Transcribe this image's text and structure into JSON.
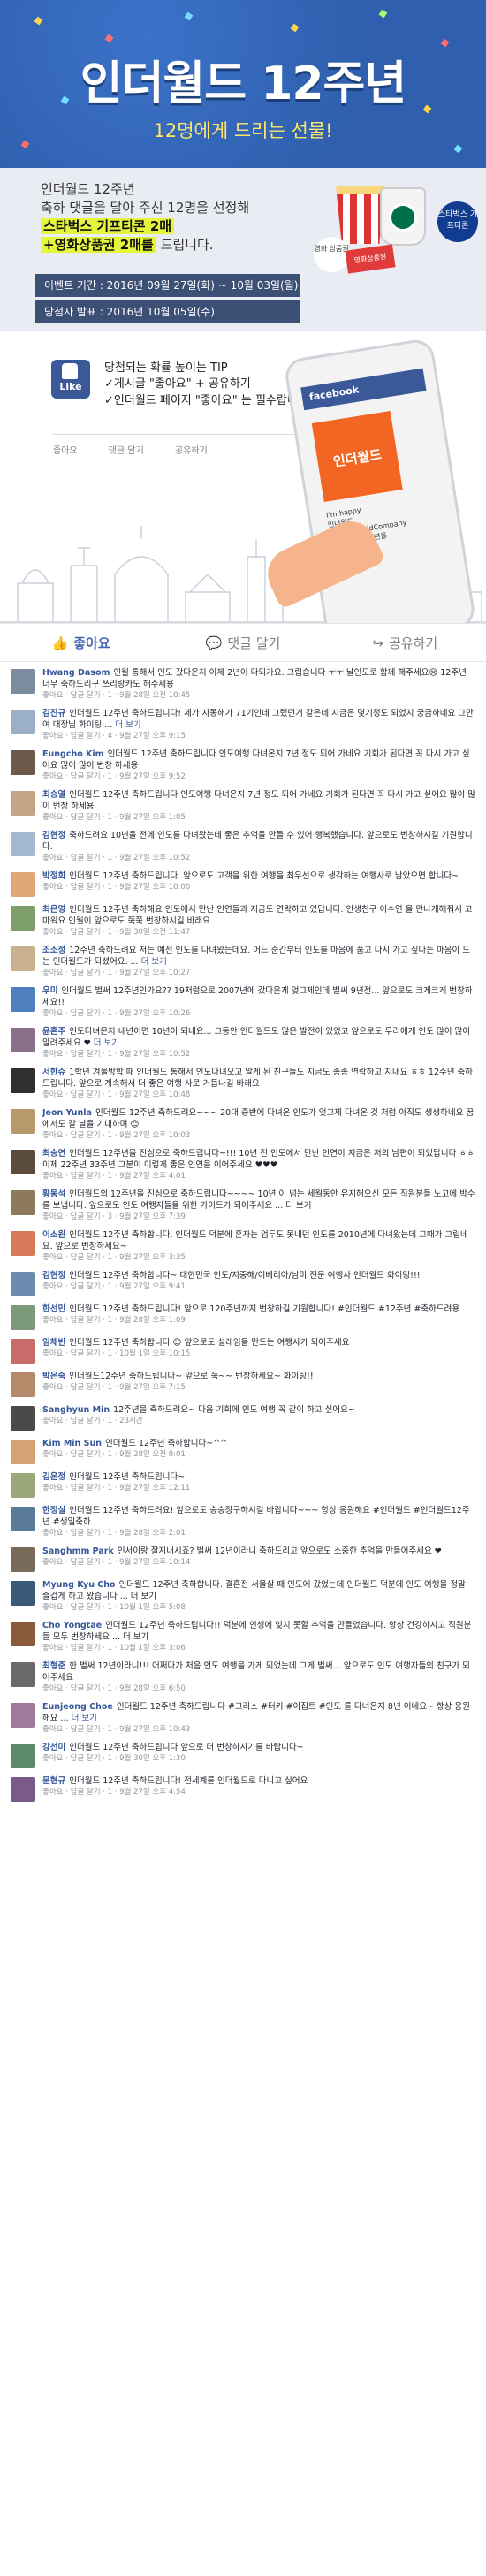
{
  "hero": {
    "title": "인더월드 12주년",
    "subtitle": "12명에게 드리는 선물!"
  },
  "event": {
    "line1": "인더월드 12주년",
    "line2": "축하 댓글을 달아 주신 12명을 선정해",
    "prize1": "스타벅스 기프티콘 2매",
    "prize2": "+영화상품권 2매를",
    "prize_suffix": " 드립니다.",
    "period": "이벤트 기간 : 2016년 09월 27일(화) ~ 10월 03일(월)",
    "announce": "당첨자 발표 : 2016년 10월 05일(수)",
    "starbucks_tag": "스타벅스 기프티콘",
    "movie_tag": "영화 상품권",
    "ticket": "영화상품권",
    "popcorn": "POPCORN"
  },
  "tip": {
    "title": "당첨되는 확률 높이는 TIP",
    "line1": "✓게시글 \"좋아요\" + 공유하기",
    "line2": "✓인더월드 페이지 \"좋아요\" 는 필수랍니다.",
    "like_badge": "Like",
    "actions": [
      "좋아요",
      "댓글 달기",
      "공유하기"
    ],
    "phone_header": "facebook",
    "phone_card": "인더월드",
    "phone_caption1": "I'm happy",
    "phone_caption2": "인더월드\n@IntheworldCompany\n인더월드 12주년을\n축하드립니다"
  },
  "actions": {
    "like": "좋아요",
    "comment": "댓글 달기",
    "share": "공유하기"
  },
  "comments": [
    {
      "name": "Hwang Dasom",
      "text": "인월 통해서 인도 갔다온지 이제 2년이 다되가요. 그립습니다 ㅜㅜ 날인도로 함께 해주세요😢 12주년 너무 축하드리구 쓰리랑카도 해주세용",
      "more": "",
      "meta": "좋아요 · 답글 달기 · 1 · 9월 28일 오전 10:45",
      "color": "#7a8c9e"
    },
    {
      "name": "김진규",
      "text": "인더월드 12주년 축하드립니다! 제가 자몽해가 71기인데 그랬던거 같은데 지금은 몇기정도 되었지 궁금하네요 그만 여 대장님 화이팅 ...",
      "more": "더 보기",
      "meta": "좋아요 · 답글 달기 · 4 · 9월 27일 오후 9:15",
      "color": "#9bb0c6"
    },
    {
      "name": "Eungcho Kim",
      "text": "인더월드 12주년 축하드립니다 인도여행 다녀온지 7년 정도 되어 가네요 기회가 된다면 꼭 다시 가고 싶어요 많이 많이 번창 하세용",
      "more": "",
      "meta": "좋아요 · 답글 달기 · 1 · 9월 27일 오후 9:52",
      "color": "#6d5a4a"
    },
    {
      "name": "최승열",
      "text": "인더월드 12주년 축하드립니다 인도여행 다녀온지 7년 정도 되어 가네요 기회가 된다면 꼭 다시 가고 싶어요 많이 많이 번창 하세용",
      "more": "",
      "meta": "좋아요 · 답글 달기 · 1 · 9월 27일 오후 1:05",
      "color": "#c4a484"
    },
    {
      "name": "김현정",
      "text": "축하드려요 10년을 전에 인도를 다녀왔는데 좋은 추억을 만들 수 있어 행복했습니다. 앞으로도 번창하시길 기원합니다.",
      "more": "",
      "meta": "좋아요 · 답글 달기 · 1 · 9월 27일 오후 10:52",
      "color": "#a3b9cf"
    },
    {
      "name": "박정희",
      "text": "인더월드 12주년 축하드립니다. 앞으로도 고객을 위한 여행을 최우선으로 생각하는 여행사로 남았으면 합니다~",
      "more": "",
      "meta": "좋아요 · 답글 달기 · 1 · 9월 27일 오후 10:00",
      "color": "#e0a878"
    },
    {
      "name": "최은영",
      "text": "인더월드 12주년 축하해요 인도에서 만난 인연들과 지금도 연락하고 있답니다. 인생친구 이수연 을 만나게해줘서 고마워요 인월이 앞으로도 쭉쭉 번창하시길 바래요",
      "more": "",
      "meta": "좋아요 · 답글 달기 · 1 · 9월 30일 오전 11:47",
      "color": "#7f9f6a"
    },
    {
      "name": "조소정",
      "text": "12주년 축하드려요 저는 예전 인도를 다녀왔는데요. 어느 순간부터 인도를 마음에 품고 다시 가고 싶다는 마음이 드는 인더월드가 되셨어요. ...",
      "more": "더 보기",
      "meta": "좋아요 · 답글 달기 · 1 · 9월 27일 오후 10:27",
      "color": "#c9b18e"
    },
    {
      "name": "우미",
      "text": "인더월드 벌써 12주년인가요?? 19처럼으로 2007년에 갔다온게 엊그제인데 벌써 9년전... 앞으로도 크게크게 번창하세요!!",
      "more": "",
      "meta": "좋아요 · 답글 달기 · 1 · 9월 27일 오후 10:26",
      "color": "#4e7fbf"
    },
    {
      "name": "윤혼주",
      "text": "인도다녀온지 내년이면 10년이 되네요... 그동안 인더월드도 많은 발전이 있었고 앞으로도 우리에게 인도 많이 많이 알려주세요 ❤",
      "more": "더 보기",
      "meta": "좋아요 · 답글 달기 · 1 · 9월 27일 오후 10:52",
      "color": "#8a6f8a"
    },
    {
      "name": "서한슈",
      "text": "1학년 겨울방학 때 인더월드 통해서 인도다녀오고 알게 된 친구들도 지금도 종종 연락하고 지내요 ㅎㅎ 12주년 축하드립니다. 앞으로 계속해서 더 좋은 여행 사로 거듭나길 바래요",
      "more": "",
      "meta": "좋아요 · 답글 달기 · 1 · 9월 27일 오후 10:48",
      "color": "#2f2f2f"
    },
    {
      "name": "Jeon Yunla",
      "text": "인더월드 12주년 축하드려요~~~ 20대 중반에 다녀온 인도가 엊그제 다녀온 것 처럼 아직도 생생하네요 꿈에서도 갈 날을 기대하며 😊",
      "more": "",
      "meta": "좋아요 · 답글 달기 · 1 · 9월 27일 오후 10:03",
      "color": "#b79a6b"
    },
    {
      "name": "최승연",
      "text": "인더월드 12주년을 진심으로 축하드립니다~!!! 10년 전 인도에서 만난 인연이 지금은 저의 남편이 되었답니다 ㅎㅎ 이제 22주년 33주년 그분이 이렇게 좋은 인연을 이어주세요 ♥♥♥",
      "more": "",
      "meta": "좋아요 · 답글 달기 · 1 · 9월 27일 오후 4:01",
      "color": "#5b4b3a"
    },
    {
      "name": "황동석",
      "text": "인더월드의 12주년을 진심으로 축하드립니다~~~~ 10년 이 넘는 세월동안 유지해오신 모든 직원분들 노고에 박수를 보냅니다. 앞으로도 인도 여행자들을 위한 가이드가 되어주세요 ... 더 보기",
      "more": "",
      "meta": "좋아요 · 답글 달기 · 3 · 9월 27일 오후 7:39",
      "color": "#8c7a5a"
    },
    {
      "name": "이소원",
      "text": "인더월드 12주년 축하합니다. 인더월드 덕분에 혼자는 엄두도 못내던 인도를 2010년에 다녀왔는데 그때가 그립네요. 앞으로 번창하세요~",
      "more": "",
      "meta": "좋아요 · 답글 달기 · 1 · 9월 27일 오후 3:35",
      "color": "#d67a5a"
    },
    {
      "name": "김현정",
      "text": "인더월드 12주년 축하합니다~ 대한민국 인도/지중해/이베리아/남미 전문 여행사 인더월드 화이팅!!!",
      "more": "",
      "meta": "좋아요 · 답글 달기 · 1 · 9월 27일 오후 9:41",
      "color": "#6b8cae"
    },
    {
      "name": "한선민",
      "text": "인더월드 12주년 축하드립니다! 앞으로 120주년까지 번창하길 기원합니다! #인더월드 #12주년 #축하드려용",
      "more": "",
      "meta": "좋아요 · 답글 달기 · 1 · 9월 28일 오후 1:09",
      "color": "#7a9a7a"
    },
    {
      "name": "임채빈",
      "text": "인더월드 12주년 축하합니다 😊 앞으로도 설레임을 만드는 여행사가 되어주세요",
      "more": "",
      "meta": "좋아요 · 답글 달기 · 1 · 10월 1일 오후 10:15",
      "color": "#c86b6b"
    },
    {
      "name": "박은숙",
      "text": "인더월드12주년 축하드립니다~ 앞으로 쭉~~ 번창하세요~ 화이팅!!",
      "more": "",
      "meta": "좋아요 · 답글 달기 · 1 · 9월 27일 오후 7:15",
      "color": "#b58a6a"
    },
    {
      "name": "Sanghyun Min",
      "text": "12주년을 축하드려요~ 다음 기회에 인도 여행 꼭 같이 하고 싶어요~",
      "more": "",
      "meta": "좋아요 · 답글 달기 · 1 · 23시간",
      "color": "#4a4a4a"
    },
    {
      "name": "Kim Min Sun",
      "text": "인더월드 12주년 축하합니다~^^",
      "more": "",
      "meta": "좋아요 · 답글 달기 · 1 · 9월 28일 오전 9:01",
      "color": "#d4a373"
    },
    {
      "name": "김은정",
      "text": "인더월드 12주년 축하드립니다~",
      "more": "",
      "meta": "좋아요 · 답글 달기 · 1 · 9월 27일 오후 12:11",
      "color": "#9aa87c"
    },
    {
      "name": "한정실",
      "text": "인더월드 12주년 축하드려요! 앞으로도 승승장구하시길 바랍니다~~~ 항상 응원해요 #인더월드 #인더월드12주년 #생일축하",
      "more": "",
      "meta": "좋아요 · 답글 달기 · 1 · 9월 28일 오후 2:01",
      "color": "#5a7a9a"
    },
    {
      "name": "Sanghmm Park",
      "text": "인서이랑 잘지내시죠? 벌써 12년이라니 축하드리고 앞으로도 소중한 추억을 만들어주세요 ❤",
      "more": "",
      "meta": "좋아요 · 답글 달기 · 1 · 9월 27일 오후 10:14",
      "color": "#7a6a5a"
    },
    {
      "name": "Myung Kyu Cho",
      "text": "인더월드 12주년 축하합니다. 결혼전 서울살 때 인도에 갔었는데 인더월드 덕분에 인도 여행을 정말 즐겁게 하고 왔습니다 ... 더 보기",
      "more": "",
      "meta": "좋아요 · 답글 달기 · 1 · 10월 1일 오후 5:08",
      "color": "#3a5a7a"
    },
    {
      "name": "Cho Yongtae",
      "text": "인더월드 12주년 축하드립니다!! 덕분에 인생에 잊지 못할 추억을 만들었습니다. 항상 건강하시고 직원분들 모두 번창하세요 ... 더 보기",
      "more": "",
      "meta": "좋아요 · 답글 달기 · 1 · 10월 1일 오후 3:06",
      "color": "#8a5a3a"
    },
    {
      "name": "최형준",
      "text": "한 벌써 12년이라니!!! 어쩌다가 처음 인도 여행을 가게 되었는데 그게 벌써... 앞으로도 인도 여행자들의 친구가 되어주세요",
      "more": "",
      "meta": "좋아요 · 답글 달기 · 1 · 9월 28일 오후 6:50",
      "color": "#6a6a6a"
    },
    {
      "name": "Eunjeong Choe",
      "text": "인더월드 12주년 축하드립니다 #그리스 #터키 #이집트 #인도 를 다녀온지 8년 이네요~ 항상 응원해요 ...",
      "more": "더 보기",
      "meta": "좋아요 · 답글 달기 · 1 · 9월 27일 오후 10:43",
      "color": "#a07a9a"
    },
    {
      "name": "강선미",
      "text": "인더월드 12주년 축하드립니다 앞으로 더 번창하시기를 바랍니다~",
      "more": "",
      "meta": "좋아요 · 답글 달기 · 1 · 9월 30일 오후 1:30",
      "color": "#5a8a6a"
    },
    {
      "name": "문현규",
      "text": "인더월드 12주년 축하드립니다! 전세계를 인더월드로 다니고 싶어요",
      "more": "",
      "meta": "좋아요 · 답글 달기 · 1 · 9월 27일 오후 4:54",
      "color": "#7a5a8a"
    }
  ],
  "colors": {
    "hero_bg": "#2f5fae",
    "title_yellow": "#ffe66b",
    "facebook_blue": "#3b5998",
    "link_blue": "#365899"
  }
}
